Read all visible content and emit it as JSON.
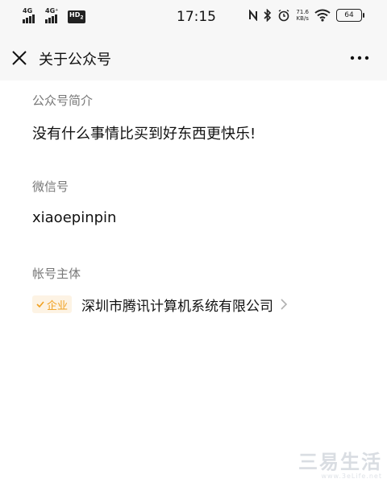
{
  "status_bar": {
    "signal1_label": "4G",
    "signal2_label": "4G⁺",
    "hd_label": "HD",
    "hd_sub": "2",
    "time": "17:15",
    "net_speed": "71.6",
    "net_unit": "KB/s",
    "battery": "64"
  },
  "nav": {
    "title": "关于公众号",
    "close_icon": "close-icon",
    "more_icon": "more-icon"
  },
  "intro": {
    "label": "公众号简介",
    "value": "没有什么事情比买到好东西更快乐!"
  },
  "wechat_id": {
    "label": "微信号",
    "value": "xiaoepinpin"
  },
  "account_entity": {
    "label": "帐号主体",
    "badge": "企业",
    "name": "深圳市腾讯计算机系统有限公司"
  },
  "watermark": {
    "text": "三易生活",
    "sub": "www.3eLife.net"
  },
  "colors": {
    "badge_text": "#f0a020",
    "badge_bg": "#fdf3e4",
    "label": "#777777"
  }
}
